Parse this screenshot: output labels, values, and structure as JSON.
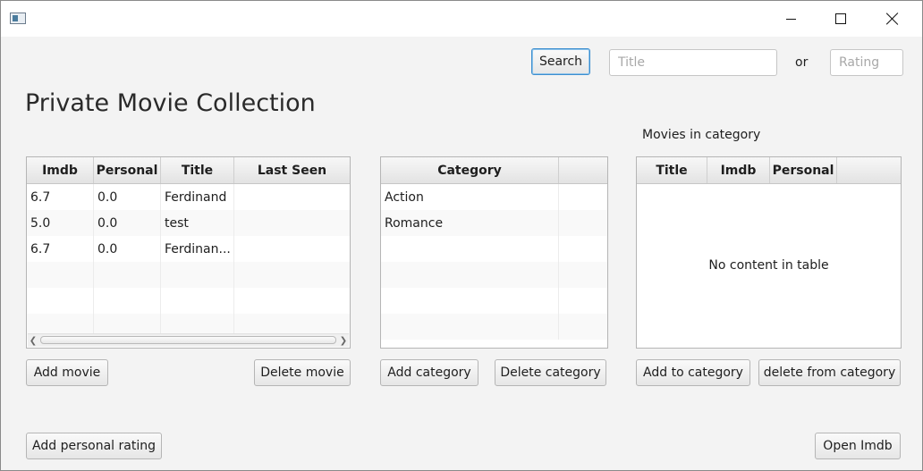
{
  "window": {
    "controls": {
      "minimize": "minimize",
      "maximize": "maximize",
      "close": "close"
    }
  },
  "search": {
    "button_label": "Search",
    "title_placeholder": "Title",
    "or_label": "or",
    "rating_placeholder": "Rating"
  },
  "heading": "Private Movie Collection",
  "movies_table": {
    "columns": [
      "Imdb",
      "Personal",
      "Title",
      "Last Seen"
    ],
    "rows": [
      [
        "6.7",
        "0.0",
        "Ferdinand",
        ""
      ],
      [
        "5.0",
        "0.0",
        "test",
        ""
      ],
      [
        "6.7",
        "0.0",
        "Ferdinan...",
        ""
      ]
    ]
  },
  "category_table": {
    "columns": [
      "Category"
    ],
    "rows": [
      [
        "Action"
      ],
      [
        "Romance"
      ]
    ]
  },
  "category_movies": {
    "label": "Movies in category",
    "columns": [
      "Title",
      "Imdb",
      "Personal"
    ],
    "empty_text": "No content in table"
  },
  "buttons": {
    "add_movie": "Add movie",
    "delete_movie": "Delete movie",
    "add_category": "Add category",
    "delete_category": "Delete category",
    "add_to_category": "Add to category",
    "delete_from_category": "delete from category",
    "add_personal_rating": "Add personal rating",
    "open_imdb": "Open Imdb"
  },
  "colors": {
    "focus_border": "#3c8ecf",
    "window_bg": "#f3f3f3"
  },
  "icons": {
    "app": "app-window-icon",
    "minimize": "minimize-icon",
    "maximize": "maximize-icon",
    "close": "close-icon"
  }
}
